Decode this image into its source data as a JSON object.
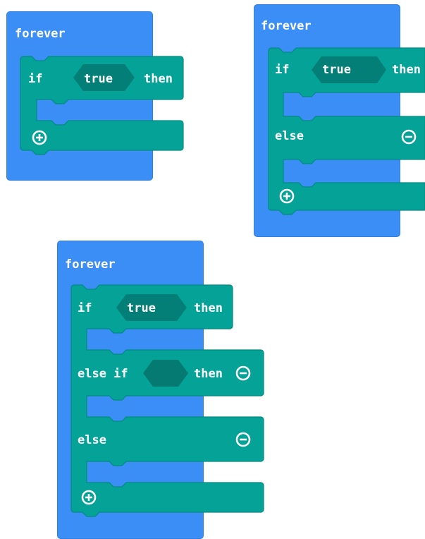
{
  "blocks": [
    {
      "event_label": "forever",
      "if_label": "if",
      "condition": "true",
      "then_label": "then"
    },
    {
      "event_label": "forever",
      "if_label": "if",
      "condition": "true",
      "then_label": "then",
      "else_label": "else"
    },
    {
      "event_label": "forever",
      "if_label": "if",
      "condition": "true",
      "then_label": "then",
      "elseif_label": "else if",
      "elseif_then_label": "then",
      "else_label": "else"
    }
  ],
  "colors": {
    "event_block": "#3b8ef5",
    "logic_block": "#04a297",
    "condition_slot": "#047f77"
  },
  "icons": [
    "plus-circle-icon",
    "minus-circle-icon"
  ]
}
